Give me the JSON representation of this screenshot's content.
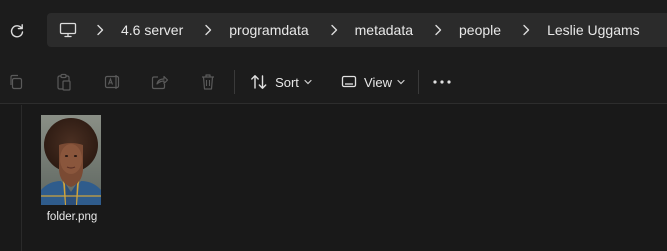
{
  "address_bar": {
    "crumbs": [
      "4.6 server",
      "programdata",
      "metadata",
      "people",
      "Leslie Uggams"
    ]
  },
  "toolbar": {
    "sort_label": "Sort",
    "view_label": "View"
  },
  "files": [
    {
      "name": "folder.png",
      "icon": "portrait-image-thumbnail"
    }
  ]
}
